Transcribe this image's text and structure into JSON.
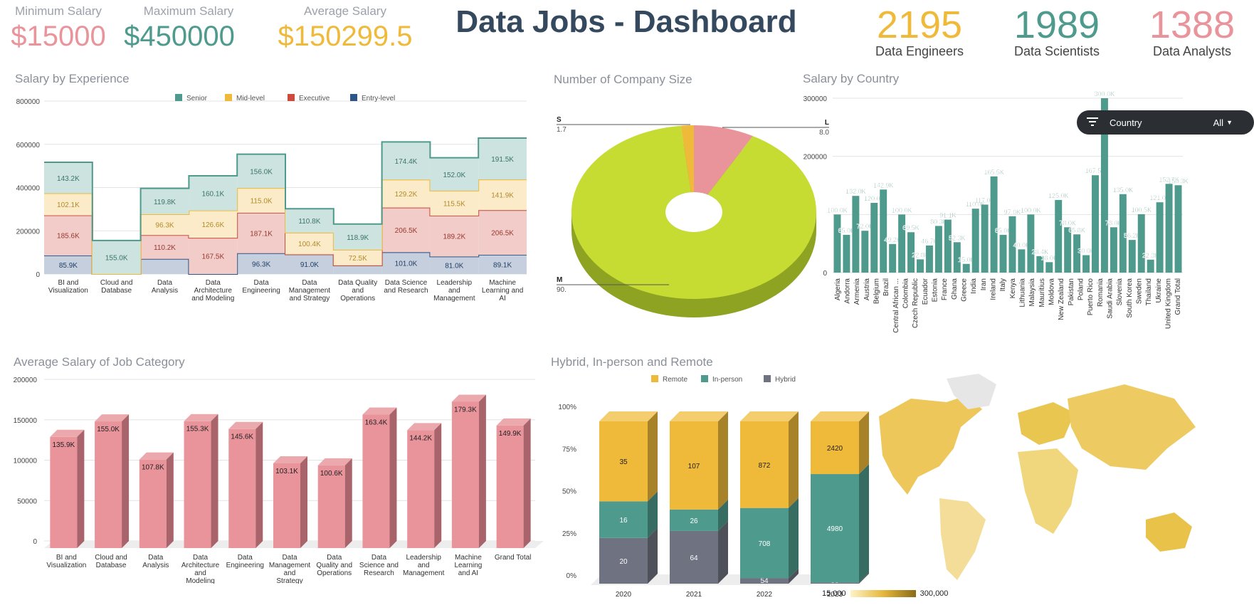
{
  "colors": {
    "pink": "#e9939b",
    "green": "#4e9a8d",
    "yellow": "#efb93a",
    "navy": "#2f5487",
    "red": "#cd4a3e",
    "title": "#34485e",
    "pieYellowGreen": "#c6dc32",
    "grey": "#6f7280"
  },
  "kpis": [
    {
      "label": "Minimum Salary",
      "value": "$15000",
      "color": "#e9939b"
    },
    {
      "label": "Maximum Salary",
      "value": "$450000",
      "color": "#4e9a8d"
    },
    {
      "label": "Average Salary",
      "value": "$150299.5",
      "color": "#efb93a"
    }
  ],
  "dashboard_title": "Data Jobs - Dashboard",
  "headcounts": [
    {
      "value": "2195",
      "label": "Data Engineers",
      "color": "#efb93a"
    },
    {
      "value": "1989",
      "label": "Data Scientists",
      "color": "#4e9a8d"
    },
    {
      "value": "1388",
      "label": "Data Analysts",
      "color": "#e9939b"
    }
  ],
  "filter": {
    "icon": "filter-icon",
    "label": "Country",
    "value": "All"
  },
  "titles": {
    "experience": "Salary by Experience",
    "company_size": "Number of Company Size",
    "country": "Salary by Country",
    "job_category": "Average Salary of Job Category",
    "work_setting": "Hybrid, In-person and Remote"
  },
  "chart_data": [
    {
      "id": "experience",
      "type": "area",
      "stacked": true,
      "title": "Salary by Experience",
      "legend": [
        "Senior",
        "Mid-level",
        "Executive",
        "Entry-level"
      ],
      "legend_colors": [
        "#4e9a8d",
        "#efb93a",
        "#cd4a3e",
        "#2f5487"
      ],
      "legend_position": "top",
      "ylim": [
        0,
        800000
      ],
      "yticks": [
        "800000",
        "600000",
        "400000",
        "200000",
        "0"
      ],
      "categories": [
        "BI and Visualization",
        "Cloud and Database",
        "Data Analysis",
        "Data Architecture and Modeling",
        "Data Engineering",
        "Data Management and Strategy",
        "Data Quality and Operations",
        "Data Science and Research",
        "Leadership and Management",
        "Machine Learning and AI"
      ],
      "series": [
        {
          "name": "Entry-level",
          "values": [
            85900,
            0,
            70000,
            0,
            96300,
            91000,
            40000,
            101000,
            81000,
            89100
          ],
          "labels": [
            "85.9K",
            "",
            "",
            "",
            "96.3K",
            "91.0K",
            "",
            "101.0K",
            "81.0K",
            "89.1K"
          ]
        },
        {
          "name": "Executive",
          "values": [
            185600,
            0,
            110200,
            167500,
            187100,
            0,
            0,
            206500,
            189200,
            206500
          ],
          "labels": [
            "185.6K",
            "",
            "110.2K",
            "167.5K",
            "187.1K",
            "",
            "",
            "206.5K",
            "189.2K",
            "206.5K"
          ]
        },
        {
          "name": "Mid-level",
          "values": [
            102100,
            0,
            96300,
            126600,
            115000,
            100400,
            72500,
            129200,
            115500,
            141900
          ],
          "labels": [
            "102.1K",
            "",
            "96.3K",
            "126.6K",
            "115.0K",
            "100.4K",
            "72.5K",
            "129.2K",
            "115.5K",
            "141.9K"
          ]
        },
        {
          "name": "Senior",
          "values": [
            143200,
            155000,
            119800,
            160100,
            156000,
            110800,
            118900,
            174400,
            152000,
            191500
          ],
          "labels": [
            "143.2K",
            "155.0K",
            "119.8K",
            "160.1K",
            "156.0K",
            "110.8K",
            "118.9K",
            "174.4K",
            "152.0K",
            "191.5K"
          ]
        }
      ]
    },
    {
      "id": "company_size",
      "type": "pie",
      "donut": true,
      "title": "Number of Company Size",
      "slices": [
        {
          "name": "L",
          "value": 8.0,
          "label": "8.0",
          "color": "#e9939b"
        },
        {
          "name": "M",
          "value": 90.3,
          "label": "90.",
          "color": "#c6dc32"
        },
        {
          "name": "S",
          "value": 1.7,
          "label": "1.7",
          "color": "#efb93a"
        }
      ]
    },
    {
      "id": "country",
      "type": "bar",
      "title": "Salary by Country",
      "ylim": [
        0,
        300000
      ],
      "yticks": [
        "300000",
        "200000",
        "0"
      ],
      "color": "#4e9a8d",
      "categories": [
        "Algeria",
        "Andorra",
        "Armenia",
        "Austria",
        "Belgium",
        "Brazil",
        "Central African ...",
        "Colombia",
        "Czech Republic",
        "Ecuador",
        "Estonia",
        "France",
        "Ghana",
        "Greece",
        "India",
        "Iran",
        "Ireland",
        "Italy",
        "Kenya",
        "Lithuania",
        "Malaysia",
        "Mauritius",
        "Moldova",
        "New Zealand",
        "Pakistan",
        "Poland",
        "Puerto Rico",
        "Romania",
        "Saudi Arabia",
        "Slovenia",
        "South Korea",
        "Sweden",
        "Thailand",
        "Ukraine",
        "United Kingdom",
        "Grand Total"
      ],
      "values": [
        100000,
        65000,
        132000,
        72000,
        120000,
        142900,
        49200,
        100000,
        69500,
        22800,
        46700,
        80300,
        91100,
        52300,
        15000,
        110000,
        117000,
        165500,
        65000,
        97000,
        40000,
        100000,
        28400,
        18000,
        125000,
        78000,
        65800,
        30000,
        167500,
        300000,
        78000,
        135000,
        56200,
        100500,
        22300,
        121000,
        152700,
        150300
      ],
      "labels": [
        "100.0K",
        "65.0K",
        "132.0K",
        "72.0K",
        "120.0K",
        "142.9K",
        "49.2K",
        "100.0K",
        "69.5K",
        "22.8K",
        "46.7K",
        "80.3K",
        "91.1K",
        "52.3K",
        "15.0K",
        "110.0K",
        "117.0K",
        "165.5K",
        "65.0K",
        "97.0K",
        "40.0K",
        "100.0K",
        "28.4K",
        "18.0K",
        "125.0K",
        "78.0K",
        "65.8K",
        "30.0K",
        "167.5K",
        "300.0K",
        "78.0K",
        "135.0K",
        "56.2K",
        "100.5K",
        "22.3K",
        "121.0K",
        "152.7K",
        "150.3K"
      ]
    },
    {
      "id": "job_category",
      "type": "bar",
      "title": "Average Salary of Job Category",
      "ylim": [
        0,
        200000
      ],
      "yticks": [
        "200000",
        "150000",
        "100000",
        "50000",
        "0"
      ],
      "color": "#e9939b",
      "categories": [
        "BI and Visualization",
        "Cloud and Database",
        "Data Analysis",
        "Data Architecture and Modeling",
        "Data Engineering",
        "Data Management and Strategy",
        "Data Quality and Operations",
        "Data Science and Research",
        "Leadership and Management",
        "Machine Learning and AI",
        "Grand Total"
      ],
      "values": [
        135900,
        155000,
        107800,
        155300,
        145600,
        103100,
        100600,
        163400,
        144200,
        179300,
        149900
      ],
      "labels": [
        "135.9K",
        "155.0K",
        "107.8K",
        "155.3K",
        "145.6K",
        "103.1K",
        "100.6K",
        "163.4K",
        "144.2K",
        "179.3K",
        "149.9K"
      ]
    },
    {
      "id": "work_setting",
      "type": "bar",
      "stacked": "percent",
      "title": "Hybrid, In-person and Remote",
      "legend": [
        "Remote",
        "In-person",
        "Hybrid"
      ],
      "legend_colors": [
        "#efb93a",
        "#4e9a8d",
        "#6f7280"
      ],
      "legend_position": "top",
      "yticks": [
        "100%",
        "75%",
        "50%",
        "25%",
        "0%"
      ],
      "categories": [
        "2020",
        "2021",
        "2022",
        "2023"
      ],
      "series": [
        {
          "name": "Hybrid",
          "values": [
            20,
            64,
            54,
            53
          ]
        },
        {
          "name": "In-person",
          "values": [
            16,
            26,
            708,
            4980
          ]
        },
        {
          "name": "Remote",
          "values": [
            35,
            107,
            872,
            2420
          ]
        }
      ]
    }
  ],
  "map": {
    "legend_min": "15,000",
    "legend_max": "300,000"
  }
}
